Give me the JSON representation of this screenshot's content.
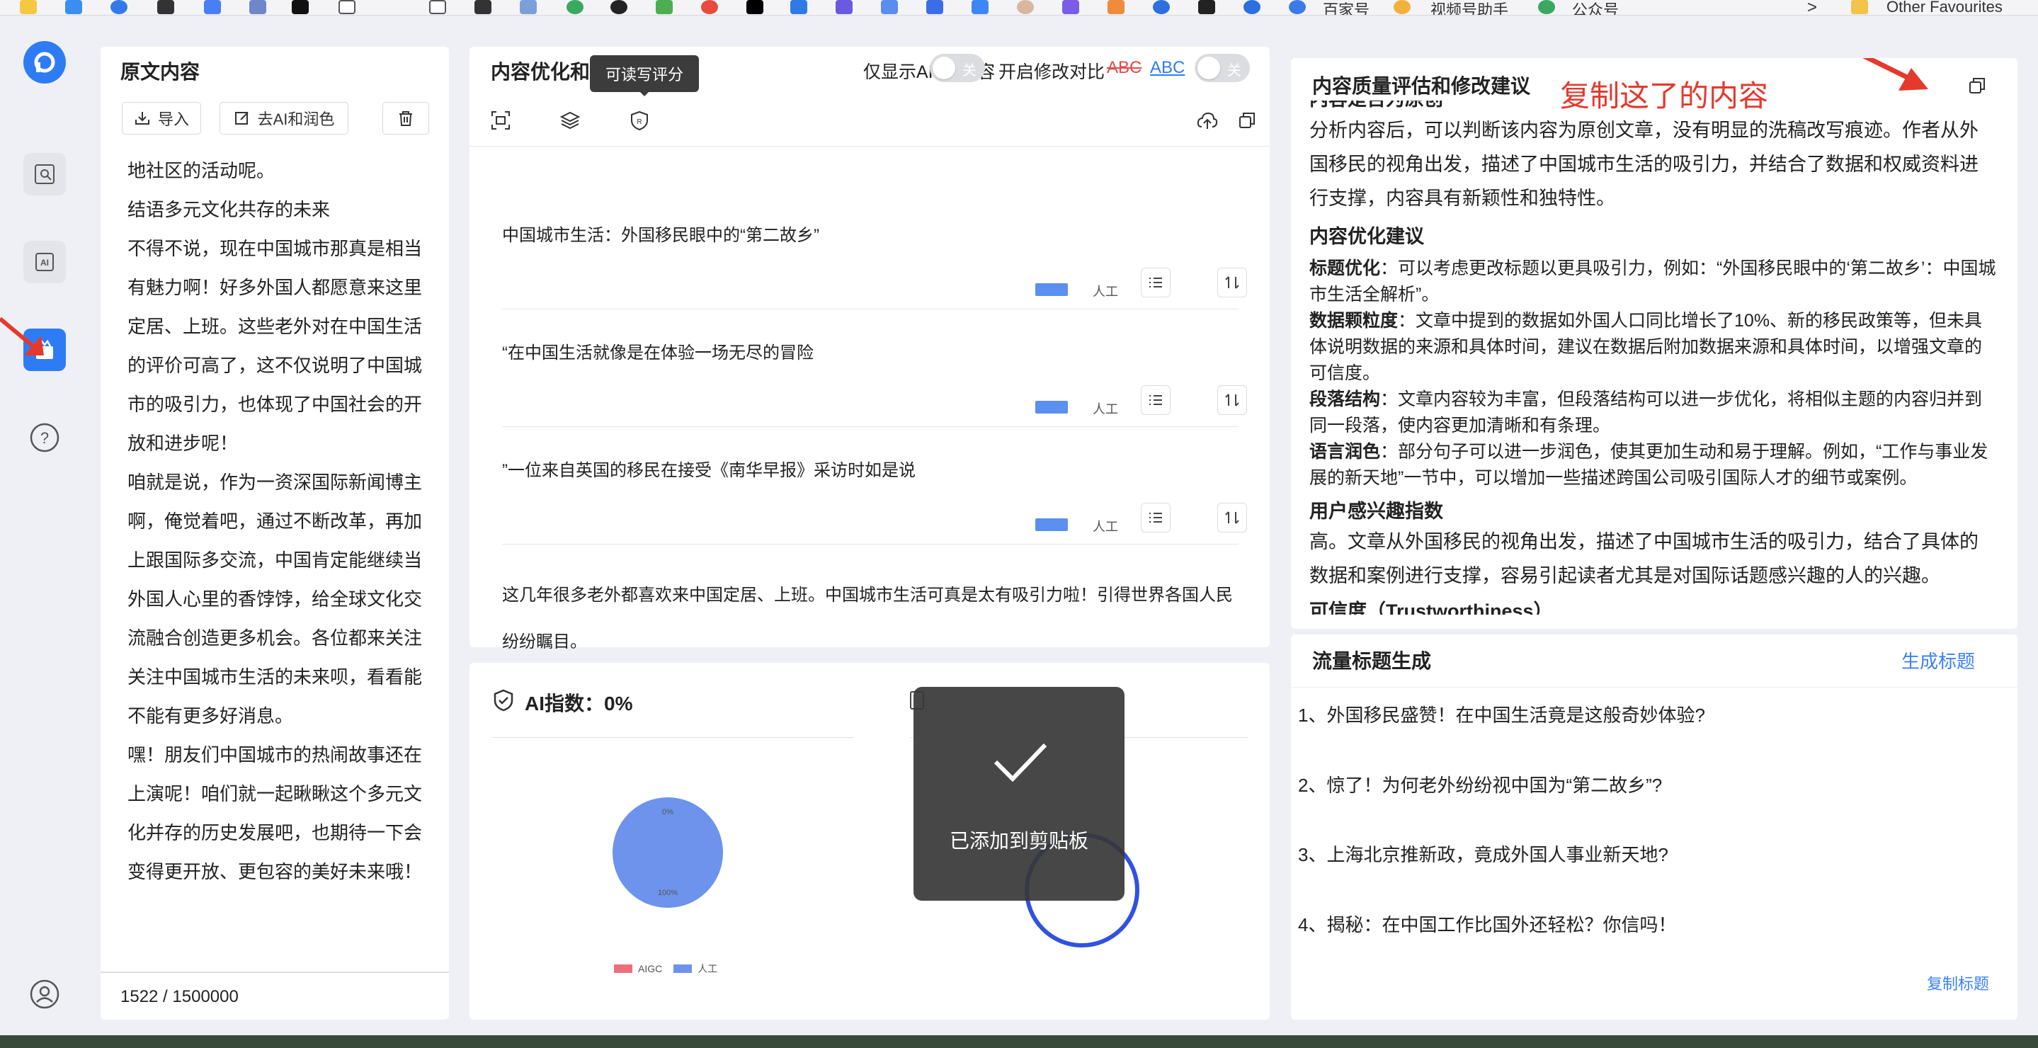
{
  "bookmarks": {
    "items": [
      "百家号",
      "视频号助手",
      "公众号"
    ],
    "more": ">",
    "other_favourites": "Other Favourites"
  },
  "left_panel": {
    "title": "原文内容",
    "import_label": "导入",
    "deai_label": "去AI和润色",
    "paragraphs": [
      "地社区的活动呢。",
      "结语多元文化共存的未来",
      "不得不说，现在中国城市那真是相当有魅力啊！好多外国人都愿意来这里定居、上班。这些老外对在中国生活的评价可高了，这不仅说明了中国城市的吸引力，也体现了中国社会的开放和进步呢！",
      "咱就是说，作为一资深国际新闻博主啊，俺觉着吧，通过不断改革，再加上跟国际多交流，中国肯定能继续当外国人心里的香饽饽，给全球文化交流融合创造更多机会。各位都来关注关注中国城市生活的未来呗，看看能不能有更多好消息。",
      "嘿！朋友们中国城市的热闹故事还在上演呢！咱们就一起瞅瞅这个多元文化并存的历史发展吧，也期待一下会变得更开放、更包容的美好未来哦！"
    ],
    "char_count": "1522 / 1500000"
  },
  "middle_panel": {
    "title": "内容优化和质量评估",
    "tooltip": "可读写评分",
    "aigc_only_label": "仅显示AIGC内容",
    "toggle_off": "关",
    "compare_label": "开启修改对比",
    "abc_strike": "ABC",
    "abc_link": "ABC",
    "cards": [
      {
        "text": "中国城市生活：外国移民眼中的“第二故乡”",
        "tag": "人工"
      },
      {
        "text": "“在中国生活就像是在体验一场无尽的冒险",
        "tag": "人工"
      },
      {
        "text": "”一位来自英国的移民在接受《南华早报》采访时如是说",
        "tag": "人工"
      },
      {
        "text": "这几年很多老外都喜欢来中国定居、上班。中国城市生活可真是太有吸引力啦！引得世界各国人民纷纷瞩目。",
        "tag": "人工"
      }
    ]
  },
  "stats_panel": {
    "ai_index_label": "AI指数：0%",
    "legend": [
      "AIGC",
      "人工"
    ],
    "toast": "已添加到剪贴板"
  },
  "chart_data": {
    "type": "pie",
    "categories": [
      "AIGC",
      "人工"
    ],
    "values": [
      0,
      100
    ],
    "labels": [
      "0%",
      "100%"
    ],
    "colors": [
      "#ee6f7c",
      "#6d93ec"
    ]
  },
  "right_panel": {
    "title": "内容质量评估和修改建议",
    "annotation": "复制这了的内容",
    "cut_heading": "内容是否为原创",
    "originality_text": "分析内容后，可以判断该内容为原创文章，没有明显的洗稿改写痕迹。作者从外国移民的视角出发，描述了中国城市生活的吸引力，并结合了数据和权威资料进行支撑，内容具有新颖性和独特性。",
    "opt_title": "内容优化建议",
    "suggestions": [
      {
        "label": "标题优化",
        "text": "：可以考虑更改标题以更具吸引力，例如：“外国移民眼中的‘第二故乡’：中国城市生活全解析”。"
      },
      {
        "label": "数据颗粒度",
        "text": "：文章中提到的数据如外国人口同比增长了10%、新的移民政策等，但未具体说明数据的来源和具体时间，建议在数据后附加数据来源和具体时间，以增强文章的可信度。"
      },
      {
        "label": "段落结构",
        "text": "：文章内容较为丰富，但段落结构可以进一步优化，将相似主题的内容归并到同一段落，使内容更加清晰和有条理。"
      },
      {
        "label": "语言润色",
        "text": "：部分句子可以进一步润色，使其更加生动和易于理解。例如，“工作与事业发展的新天地”一节中，可以增加一些描述跨国公司吸引国际人才的细节或案例。"
      }
    ],
    "interest_title": "用户感兴趣指数",
    "interest_text": "高。文章从外国移民的视角出发，描述了中国城市生活的吸引力，结合了具体的数据和案例进行支撑，容易引起读者尤其是对国际话题感兴趣的人的兴趣。",
    "trust_title": "可信度（Trustworthiness）"
  },
  "titles_panel": {
    "title": "流量标题生成",
    "generate_label": "生成标题",
    "items": [
      "1、外国移民盛赞！在中国生活竟是这般奇妙体验?",
      "2、惊了！为何老外纷纷视中国为“第二故乡”?",
      "3、上海北京推新政，竟成外国人事业新天地?",
      "4、揭秘：在中国工作比国外还轻松？你信吗！"
    ],
    "copy_label": "复制标题"
  }
}
